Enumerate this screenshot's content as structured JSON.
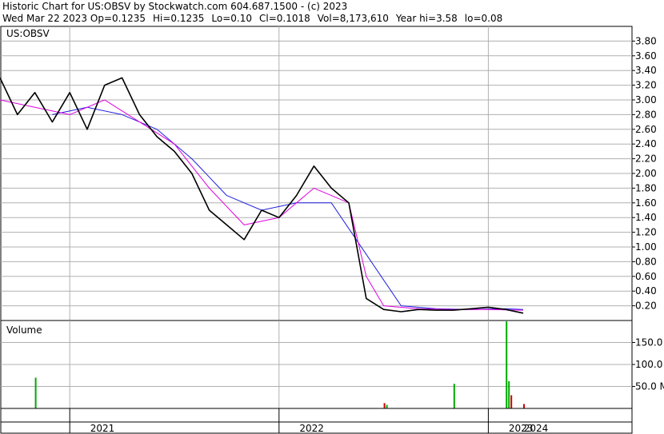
{
  "header": {
    "line1": "Historic Chart for US:OBSV by Stockwatch.com 604.687.1500 - (c) 2023",
    "date": "Wed Mar 22 2023",
    "stats": {
      "open": "Op=0.1235",
      "high": "Hi=0.1235",
      "low": "Lo=0.10",
      "close": "Cl=0.1018",
      "volume": "Vol=8,173,610",
      "year_high": "Year hi=3.58",
      "year_low": "lo=0.08"
    }
  },
  "colors": {
    "price": "#000000",
    "ma_short": "#e000e0",
    "ma_long": "#2020e0",
    "volume_up": "#00aa00",
    "volume_down": "#cc0000",
    "grid": "#b0b0b0"
  },
  "chart_data": [
    {
      "type": "line",
      "title": "US:OBSV",
      "ylim": [
        0,
        4.0
      ],
      "yticks": [
        0.2,
        0.4,
        0.6,
        0.8,
        1.0,
        1.2,
        1.4,
        1.6,
        1.8,
        2.0,
        2.2,
        2.4,
        2.6,
        2.8,
        3.0,
        3.2,
        3.4,
        3.6,
        3.8
      ],
      "ytick_labels": [
        "0.20",
        "0.40",
        "0.60",
        "0.80",
        "1.00",
        "1.20",
        "1.40",
        "1.60",
        "1.80",
        "2.00",
        "2.20",
        "2.40",
        "2.60",
        "2.80",
        "3.00",
        "3.20",
        "3.40",
        "3.60",
        "3.80"
      ],
      "x_categories": [
        "2021",
        "2022",
        "2023",
        "2024"
      ],
      "grid": true,
      "series": [
        {
          "role": "price",
          "x": [
            "2020-09",
            "2020-10",
            "2020-11",
            "2020-12",
            "2021-01",
            "2021-02",
            "2021-03",
            "2021-04",
            "2021-05",
            "2021-06",
            "2021-07",
            "2021-08",
            "2021-09",
            "2021-10",
            "2021-11",
            "2021-12",
            "2022-01",
            "2022-02",
            "2022-03",
            "2022-04",
            "2022-05",
            "2022-06",
            "2022-07",
            "2022-08",
            "2022-09",
            "2022-10",
            "2022-11",
            "2022-12",
            "2023-01",
            "2023-02",
            "2023-03"
          ],
          "y": [
            3.3,
            2.8,
            3.1,
            2.7,
            3.1,
            2.6,
            3.2,
            3.3,
            2.8,
            2.5,
            2.3,
            2.0,
            1.5,
            1.3,
            1.1,
            1.5,
            1.4,
            1.7,
            2.1,
            1.8,
            1.6,
            0.3,
            0.15,
            0.12,
            0.15,
            0.14,
            0.14,
            0.16,
            0.18,
            0.15,
            0.1
          ]
        },
        {
          "role": "moving-average-short",
          "x": [
            "2020-09",
            "2020-11",
            "2021-01",
            "2021-03",
            "2021-05",
            "2021-07",
            "2021-09",
            "2021-11",
            "2022-01",
            "2022-03",
            "2022-05",
            "2022-06",
            "2022-07",
            "2022-09",
            "2022-11",
            "2023-01",
            "2023-03"
          ],
          "y": [
            3.0,
            2.9,
            2.8,
            3.0,
            2.7,
            2.4,
            1.8,
            1.3,
            1.4,
            1.8,
            1.6,
            0.6,
            0.2,
            0.16,
            0.15,
            0.15,
            0.14
          ]
        },
        {
          "role": "moving-average-long",
          "x": [
            "2020-12",
            "2021-02",
            "2021-04",
            "2021-06",
            "2021-08",
            "2021-10",
            "2021-12",
            "2022-02",
            "2022-04",
            "2022-06",
            "2022-08",
            "2022-10",
            "2022-12",
            "2023-02",
            "2023-03"
          ],
          "y": [
            2.8,
            2.9,
            2.8,
            2.6,
            2.2,
            1.7,
            1.5,
            1.6,
            1.6,
            0.9,
            0.2,
            0.16,
            0.15,
            0.16,
            0.15
          ]
        }
      ]
    },
    {
      "type": "bar",
      "title": "Volume",
      "ylim": [
        0,
        200
      ],
      "yticks": [
        50,
        100,
        150
      ],
      "ytick_labels": [
        "50.0 M",
        "100.0",
        "150.0"
      ],
      "spikes": [
        {
          "x": "2020-11",
          "value": 70,
          "color": "up"
        },
        {
          "x": "2022-07",
          "value": 12,
          "color": "down"
        },
        {
          "x": "2022-07",
          "value": 8,
          "color": "up"
        },
        {
          "x": "2022-11",
          "value": 56,
          "color": "up"
        },
        {
          "x": "2023-02",
          "value": 198,
          "color": "up"
        },
        {
          "x": "2023-02",
          "value": 62,
          "color": "up"
        },
        {
          "x": "2023-02",
          "value": 30,
          "color": "down"
        },
        {
          "x": "2023-03",
          "value": 10,
          "color": "down"
        }
      ]
    }
  ]
}
